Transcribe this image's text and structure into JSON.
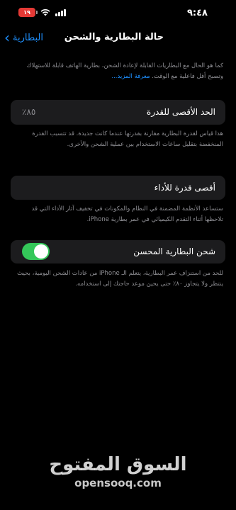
{
  "status_bar": {
    "time": "٩:٤٨",
    "battery_level": "١٩",
    "battery_color": "#e53935"
  },
  "nav": {
    "back_label": "البطارية",
    "title": "حالة البطارية والشحن"
  },
  "intro": {
    "text": "كما هو الحال مع البطاريات القابلة لإعادة الشحن، بطارية الهاتف قابلة للاستهلاك وتصبح أقل فاعلية مع الوقت.",
    "link": "معرفة المزيد..."
  },
  "max_capacity": {
    "label": "الحد الأقصى للقدرة",
    "value": "٨٥٪",
    "footnote": "هذا قياس لقدرة البطارية مقارنة بقدرتها عندما كانت جديدة. قد تتسبب القدرة المنخفضة بتقليل ساعات الاستخدام بين عملية الشحن والأخرى."
  },
  "peak_performance": {
    "label": "أقصى قدرة للأداء",
    "footnote": "ستساعد الأنظمة المضمنة في النظام والمكونات في تخفيف آثار الأداء التي قد تلاحظها أثناء التقدم الكيميائي في عمر بطارية iPhone."
  },
  "optimized_charging": {
    "label": "شحن البطارية المحسن",
    "enabled": true,
    "toggle_color": "#34c759",
    "footnote": "للحد من استنزاف عمر البطارية، يتعلم الـ iPhone من عادات الشحن اليومية، بحيث ينتظر ولا يتجاوز ٨٠٪ حتى يحين موعد حاجتك إلى استخدامه."
  },
  "watermark": {
    "arabic": "السوق المفتوح",
    "latin": "opensooq.com"
  },
  "icons": [
    "wifi-icon",
    "signal-icon",
    "battery-icon",
    "chevron-left-icon"
  ]
}
